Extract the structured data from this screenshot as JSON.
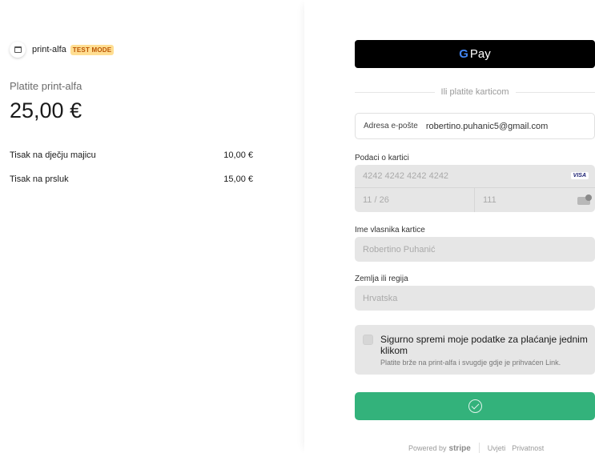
{
  "merchant": {
    "name": "print-alfa",
    "badge": "TEST MODE",
    "badge_color": "#ffde92"
  },
  "summary": {
    "pay_label": "Platite print-alfa",
    "amount": "25,00 €",
    "items": [
      {
        "name": "Tisak na dječju majicu",
        "price": "10,00 €"
      },
      {
        "name": "Tisak na prsluk",
        "price": "15,00 €"
      }
    ]
  },
  "checkout": {
    "gpay_label": "Pay",
    "divider_text": "Ili platite karticom",
    "email": {
      "label": "Adresa e-pošte",
      "value": "robertino.puhanic5@gmail.com"
    },
    "card": {
      "label": "Podaci o kartici",
      "number": "4242 4242 4242 4242",
      "brand": "VISA",
      "expiry": "11 / 26",
      "cvc": "111"
    },
    "holder": {
      "label": "Ime vlasnika kartice",
      "value": "Robertino Puhanić"
    },
    "country": {
      "label": "Zemlja ili regija",
      "value": "Hrvatska"
    },
    "link": {
      "title": "Sigurno spremi moje podatke za plaćanje jednim klikom",
      "subtitle": "Platite brže na print-alfa i svugdje gdje je prihvaćen Link."
    },
    "pay_button_color": "#33b27b"
  },
  "footer": {
    "powered_by": "Powered by",
    "stripe": "stripe",
    "terms": "Uvjeti",
    "privacy": "Privatnost"
  }
}
